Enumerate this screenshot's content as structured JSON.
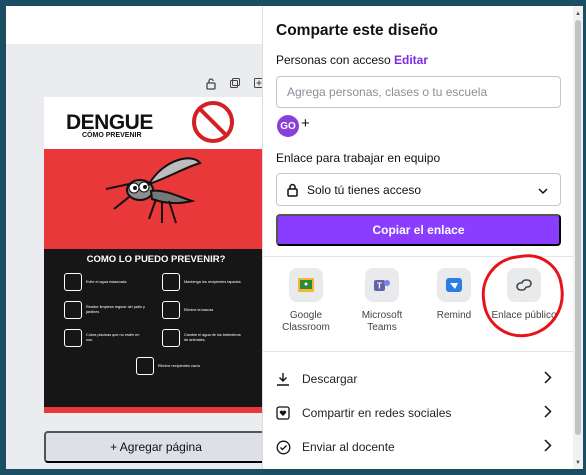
{
  "editor": {
    "design": {
      "title": "DENGUE",
      "subtitle": "CÓMO PREVENIR",
      "section_title": "COMO LO PUEDO PREVENIR?",
      "tips": [
        "Evite el agua estancada",
        "Mantenga los recipientes tapados",
        "Realice limpieza regular del patio y jardines",
        "Elimine la basura",
        "Cubra piscinas que no estén en uso.",
        "Cambie el agua de los bebederos de animales.",
        "Elimine recipientes vacío"
      ]
    },
    "add_page_label": "+ Agregar página"
  },
  "share_panel": {
    "title": "Comparte este diseño",
    "access_label": "Personas con acceso",
    "edit_label": "Editar",
    "people_placeholder": "Agrega personas, clases o tu escuela",
    "avatar_initials": "GO",
    "add_person_symbol": "+",
    "team_link_label": "Enlace para trabajar en equipo",
    "access_option": "Solo tú tienes acceso",
    "copy_button": "Copiar el enlace",
    "share_options": [
      {
        "label": "Google Classroom",
        "icon": "google-classroom-icon",
        "color": "#f6b62d"
      },
      {
        "label": "Microsoft Teams",
        "icon": "microsoft-teams-icon",
        "color": "#6264a7"
      },
      {
        "label": "Remind",
        "icon": "remind-icon",
        "color": "#2b7de1"
      },
      {
        "label": "Enlace público",
        "icon": "link-icon",
        "color": "#444444"
      }
    ],
    "actions": [
      {
        "label": "Descargar",
        "icon": "download-icon"
      },
      {
        "label": "Compartir en redes sociales",
        "icon": "heart-icon"
      },
      {
        "label": "Enviar al docente",
        "icon": "check-circle-icon"
      }
    ]
  },
  "colors": {
    "accent": "#8b3dff",
    "frame": "#1b4e63",
    "annotation": "#e8131a"
  }
}
